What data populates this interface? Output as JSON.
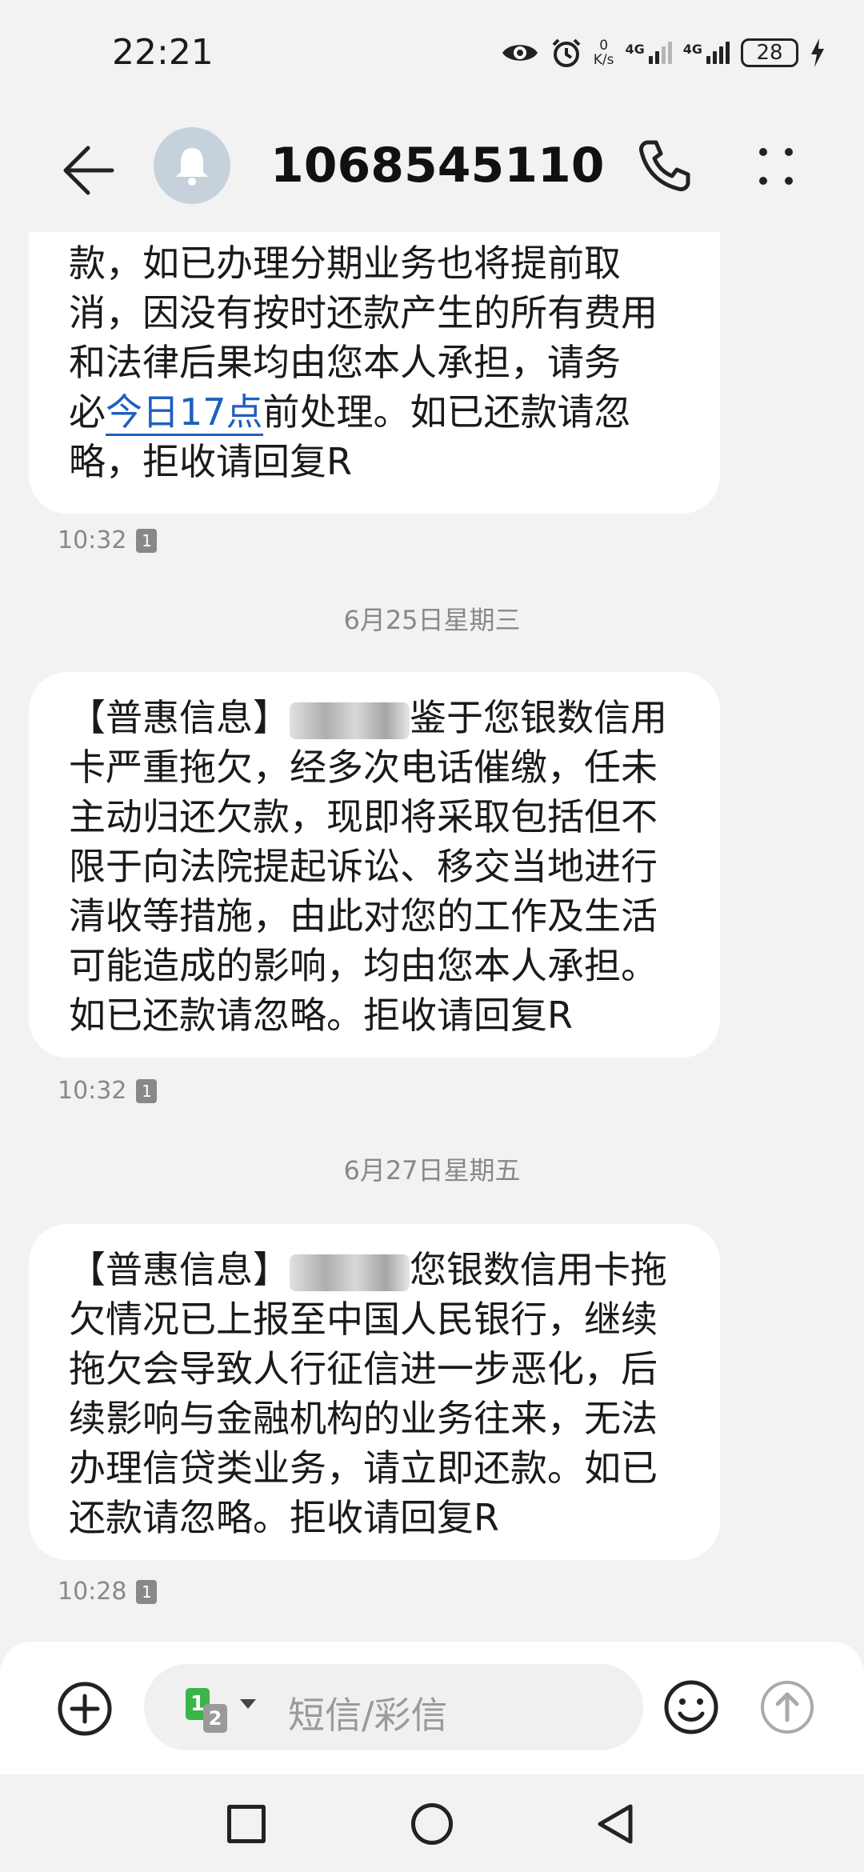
{
  "status_bar": {
    "time": "22:21",
    "speed_value": "0",
    "speed_unit": "K/s",
    "net1": "4G",
    "net2": "4G",
    "battery": "28"
  },
  "header": {
    "contact": "1068545110..."
  },
  "messages": [
    {
      "lines": [
        "款，如已办理分期业务也将提前取",
        "消，因没有按时还款产生的所有费用",
        "和法律后果均由您本人承担，请务"
      ],
      "line4_prefix": "必",
      "line4_link": "今日17点",
      "line4_suffix": "前处理。如已还款请忽",
      "line5": "略，拒收请回复R",
      "time": "10:32",
      "sim": "1"
    },
    {
      "prefix": "【普惠信息】",
      "first_suffix": "鉴于您银数信用",
      "lines": [
        "卡严重拖欠，经多次电话催缴，任未",
        "主动归还欠款，现即将采取包括但不",
        "限于向法院提起诉讼、移交当地进行",
        "清收等措施，由此对您的工作及生活",
        "可能造成的影响，均由您本人承担。",
        "如已还款请忽略。拒收请回复R"
      ],
      "time": "10:32",
      "sim": "1"
    },
    {
      "prefix": "【普惠信息】",
      "first_suffix": "您银数信用卡拖",
      "lines": [
        "欠情况已上报至中国人民银行，继续",
        "拖欠会导致人行征信进一步恶化，后",
        "续影响与金融机构的业务往来，无法",
        "办理信贷类业务，请立即还款。如已",
        "还款请忽略。拒收请回复R"
      ],
      "time": "10:28",
      "sim": "1"
    }
  ],
  "dates": [
    "6月25日星期三",
    "6月27日星期五"
  ],
  "input": {
    "placeholder": "短信/彩信",
    "sim_primary": "1",
    "sim_secondary": "2"
  }
}
